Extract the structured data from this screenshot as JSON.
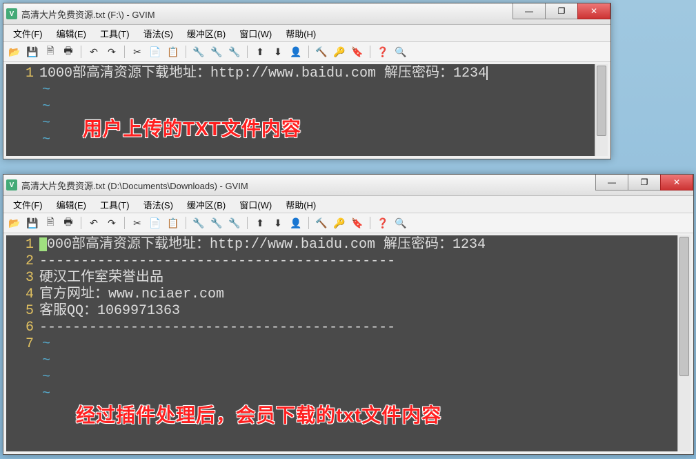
{
  "window1": {
    "title": "高清大片免费资源.txt (F:\\) - GVIM",
    "menus": [
      "文件(F)",
      "编辑(E)",
      "工具(T)",
      "语法(S)",
      "缓冲区(B)",
      "窗口(W)",
      "帮助(H)"
    ],
    "lines": [
      {
        "num": "1",
        "text": "1000部高清资源下载地址：http://www.baidu.com 解压密码：1234"
      }
    ],
    "tildes": 4
  },
  "window2": {
    "title": "高清大片免费资源.txt (D:\\Documents\\Downloads) - GVIM",
    "menus": [
      "文件(F)",
      "编辑(E)",
      "工具(T)",
      "语法(S)",
      "缓冲区(B)",
      "窗口(W)",
      "帮助(H)"
    ],
    "lines": [
      {
        "num": "1",
        "text": "1000部高清资源下载地址：http://www.baidu.com 解压密码：1234",
        "cursor": true
      },
      {
        "num": "2",
        "text": ""
      },
      {
        "num": "3",
        "text": "-------------------------------------------"
      },
      {
        "num": "4",
        "text": "硬汉工作室荣誉出品"
      },
      {
        "num": "5",
        "text": "官方网址：www.nciaer.com"
      },
      {
        "num": "6",
        "text": "客服QQ：1069971363"
      },
      {
        "num": "7",
        "text": "-------------------------------------------"
      }
    ],
    "tildes": 4
  },
  "win_controls": {
    "min": "—",
    "max": "❐",
    "close": "✕"
  },
  "annotations": {
    "a1": "用户上传的TXT文件内容",
    "a2": "经过插件处理后，会员下载的txt文件内容"
  },
  "toolbar_icons": [
    "📂",
    "💾",
    "🗎",
    "🖶",
    "|",
    "↶",
    "↷",
    "|",
    "✂",
    "📄",
    "📋",
    "|",
    "🔧",
    "🔧",
    "🔧",
    "|",
    "⬆",
    "⬇",
    "👤",
    "|",
    "🔨",
    "🔑",
    "🔖",
    "|",
    "❓",
    "🔍"
  ]
}
